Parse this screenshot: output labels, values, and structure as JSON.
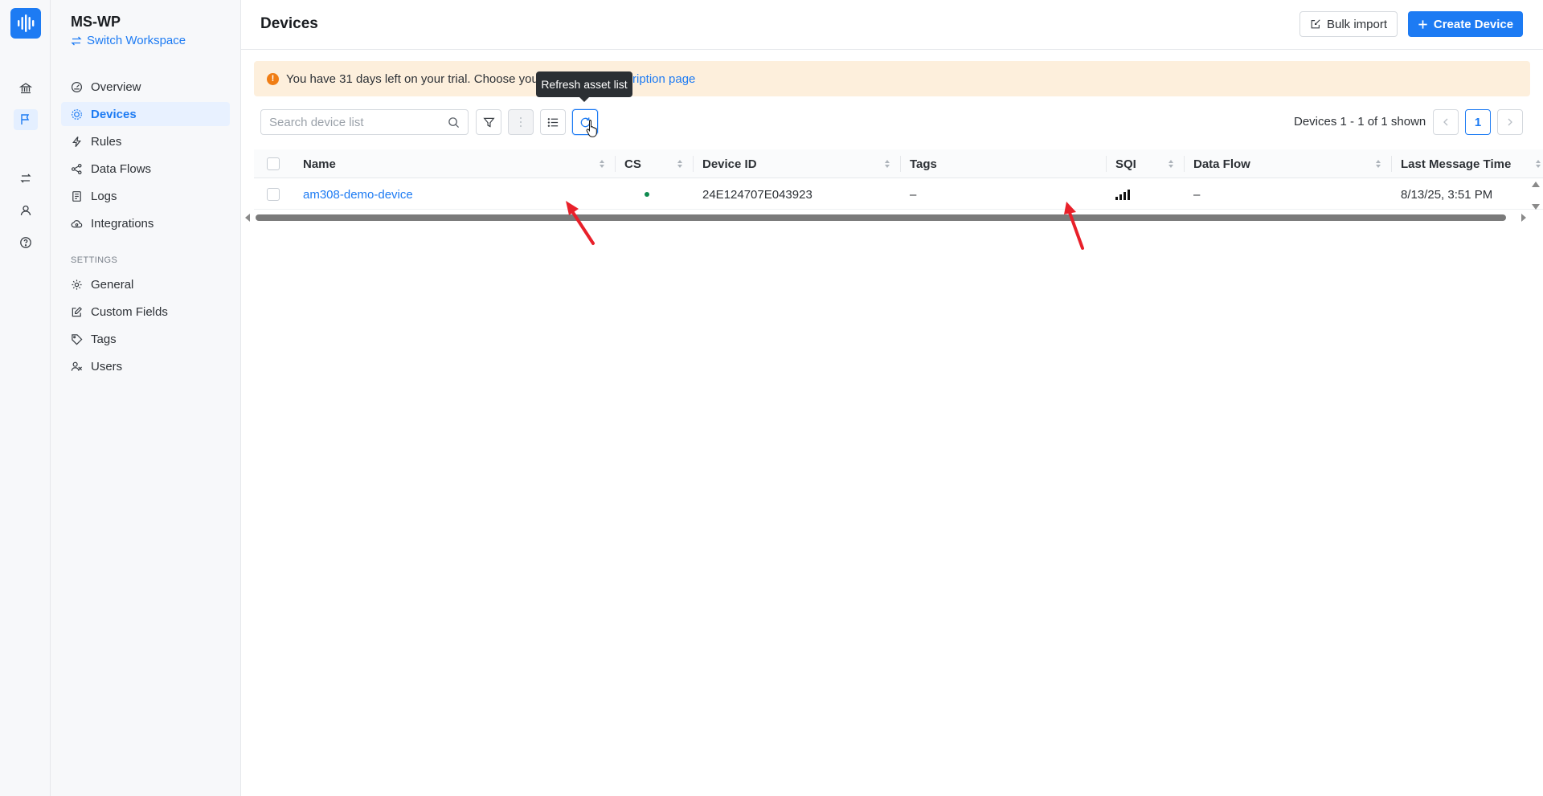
{
  "workspace": {
    "name": "MS-WP",
    "switch_label": "Switch Workspace"
  },
  "sidebar": {
    "items": [
      {
        "label": "Overview",
        "icon": "gauge-icon"
      },
      {
        "label": "Devices",
        "icon": "chip-icon"
      },
      {
        "label": "Rules",
        "icon": "bolt-icon"
      },
      {
        "label": "Data Flows",
        "icon": "share-icon"
      },
      {
        "label": "Logs",
        "icon": "log-icon"
      },
      {
        "label": "Integrations",
        "icon": "cloud-icon"
      }
    ],
    "settings_header": "SETTINGS",
    "settings_items": [
      {
        "label": "General",
        "icon": "gear-icon"
      },
      {
        "label": "Custom Fields",
        "icon": "edit-icon"
      },
      {
        "label": "Tags",
        "icon": "tag-icon"
      },
      {
        "label": "Users",
        "icon": "users-icon"
      }
    ]
  },
  "header": {
    "title": "Devices",
    "bulk_import_label": "Bulk import",
    "create_device_label": "Create Device"
  },
  "banner": {
    "text": "You have 31 days left on your trial. Choose your",
    "link_tail": "ription page"
  },
  "tooltip": {
    "text": "Refresh asset list"
  },
  "search": {
    "placeholder": "Search device list"
  },
  "pagination": {
    "summary": "Devices 1 - 1 of 1 shown",
    "current_page": "1"
  },
  "table": {
    "columns": [
      "Name",
      "CS",
      "Device ID",
      "Tags",
      "SQI",
      "Data Flow",
      "Last Message Time"
    ],
    "rows": [
      {
        "name": "am308-demo-device",
        "cs_status": "online",
        "device_id": "24E124707E043923",
        "tags": "–",
        "sqi_bars": 4,
        "data_flow": "–",
        "last_message_time": "8/13/25, 3:51 PM"
      }
    ]
  },
  "colors": {
    "accent": "#1d7bf3",
    "warning": "#f07d14",
    "banner_bg": "#fdefdc",
    "status_online": "#0f8a4f",
    "annotation_arrow": "#e8202a"
  }
}
